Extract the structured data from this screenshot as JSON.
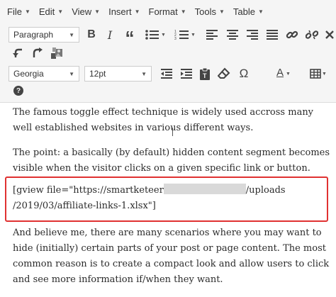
{
  "menubar": {
    "items": [
      {
        "label": "File"
      },
      {
        "label": "Edit"
      },
      {
        "label": "View"
      },
      {
        "label": "Insert"
      },
      {
        "label": "Format"
      },
      {
        "label": "Tools"
      },
      {
        "label": "Table"
      }
    ]
  },
  "toolbar": {
    "block_format": "Paragraph",
    "font_family": "Georgia",
    "font_size": "12pt",
    "bold_label": "B",
    "italic_label": "I",
    "blockquote_label": "“",
    "special_char_label": "Ω",
    "text_color_label": "A",
    "help_label": "?",
    "colors": {
      "icon": "#444444",
      "text_color_underline": "#222222"
    }
  },
  "content": {
    "paragraphs": [
      "The famous toggle effect technique is widely used accross many well established websites in various different ways.",
      "The point: a basically (by default) hidden content segment becomes visible when the visitor clicks on a given specific link or button.",
      "And believe me, there are many scenarios where you may want to hide (initially) certain parts of your post or page content. The most common reason is to create a compact look and allow users to click and see more information if/when they want."
    ],
    "shortcode": {
      "part1": "[gview file=\"https://smartketeer",
      "part2": "/uploads",
      "part3": "/2019/03/affiliate-links-1.xlsx\"]"
    },
    "highlight_color": "#e03131"
  }
}
